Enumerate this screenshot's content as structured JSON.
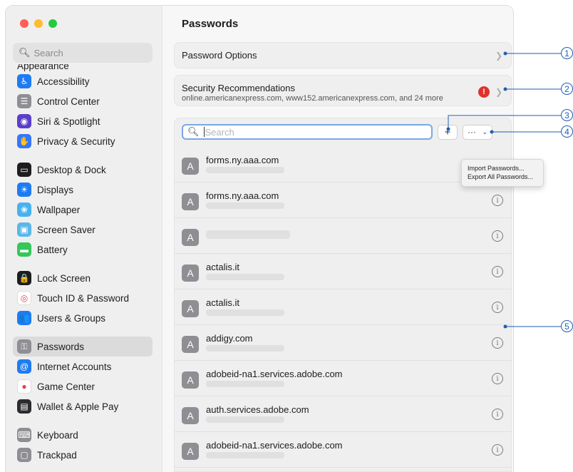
{
  "sidebar": {
    "search_placeholder": "Search",
    "cut_item": "Appearance",
    "items": [
      {
        "label": "Accessibility",
        "icon": "accessibility-icon",
        "color": "#1e7cf2",
        "glyph": "♿"
      },
      {
        "label": "Control Center",
        "icon": "control-center-icon",
        "color": "#8e8e93",
        "glyph": "☰"
      },
      {
        "label": "Siri & Spotlight",
        "icon": "siri-icon",
        "color": "#5a3fc8",
        "glyph": "◉"
      },
      {
        "label": "Privacy & Security",
        "icon": "hand-icon",
        "color": "#3478f6",
        "glyph": "✋"
      },
      {
        "label": "Desktop & Dock",
        "icon": "desktop-dock-icon",
        "color": "#1d1d1f",
        "glyph": "▭"
      },
      {
        "label": "Displays",
        "icon": "displays-icon",
        "color": "#1e7cf2",
        "glyph": "☀"
      },
      {
        "label": "Wallpaper",
        "icon": "wallpaper-icon",
        "color": "#48b2f0",
        "glyph": "❀"
      },
      {
        "label": "Screen Saver",
        "icon": "screen-saver-icon",
        "color": "#5ab7e8",
        "glyph": "▣"
      },
      {
        "label": "Battery",
        "icon": "battery-icon",
        "color": "#34c759",
        "glyph": "▬"
      },
      {
        "label": "Lock Screen",
        "icon": "lock-icon",
        "color": "#1d1d1f",
        "glyph": "🔒"
      },
      {
        "label": "Touch ID & Password",
        "icon": "fingerprint-icon",
        "color": "#ffffff",
        "glyph": "◎"
      },
      {
        "label": "Users & Groups",
        "icon": "users-icon",
        "color": "#1e7cf2",
        "glyph": "👥"
      },
      {
        "label": "Passwords",
        "icon": "key-icon",
        "color": "#8e8e93",
        "glyph": "⚿"
      },
      {
        "label": "Internet Accounts",
        "icon": "at-icon",
        "color": "#1e7cf2",
        "glyph": "@"
      },
      {
        "label": "Game Center",
        "icon": "game-center-icon",
        "color": "#ffffff",
        "glyph": "●"
      },
      {
        "label": "Wallet & Apple Pay",
        "icon": "wallet-icon",
        "color": "#2c2c2e",
        "glyph": "▤"
      },
      {
        "label": "Keyboard",
        "icon": "keyboard-icon",
        "color": "#8e8e93",
        "glyph": "⌨"
      },
      {
        "label": "Trackpad",
        "icon": "trackpad-icon",
        "color": "#8e8e93",
        "glyph": "▢"
      }
    ]
  },
  "main": {
    "title": "Passwords",
    "options_label": "Password Options",
    "security": {
      "title": "Security Recommendations",
      "subtitle": "online.americanexpress.com, www152.americanexpress.com, and 24 more",
      "alert": "!"
    },
    "search_placeholder": "Search",
    "plus": "+",
    "more": "···",
    "menu": [
      "Import Passwords...",
      "Export All Passwords..."
    ],
    "entries": [
      {
        "site": "forms.ny.aaa.com",
        "initial": "A"
      },
      {
        "site": "forms.ny.aaa.com",
        "initial": "A"
      },
      {
        "site": "",
        "initial": "A"
      },
      {
        "site": "actalis.it",
        "initial": "A"
      },
      {
        "site": "actalis.it",
        "initial": "A"
      },
      {
        "site": "addigy.com",
        "initial": "A"
      },
      {
        "site": "adobeid-na1.services.adobe.com",
        "initial": "A"
      },
      {
        "site": "auth.services.adobe.com",
        "initial": "A"
      },
      {
        "site": "adobeid-na1.services.adobe.com",
        "initial": "A"
      }
    ]
  },
  "callouts": [
    "1",
    "2",
    "3",
    "4",
    "5"
  ]
}
